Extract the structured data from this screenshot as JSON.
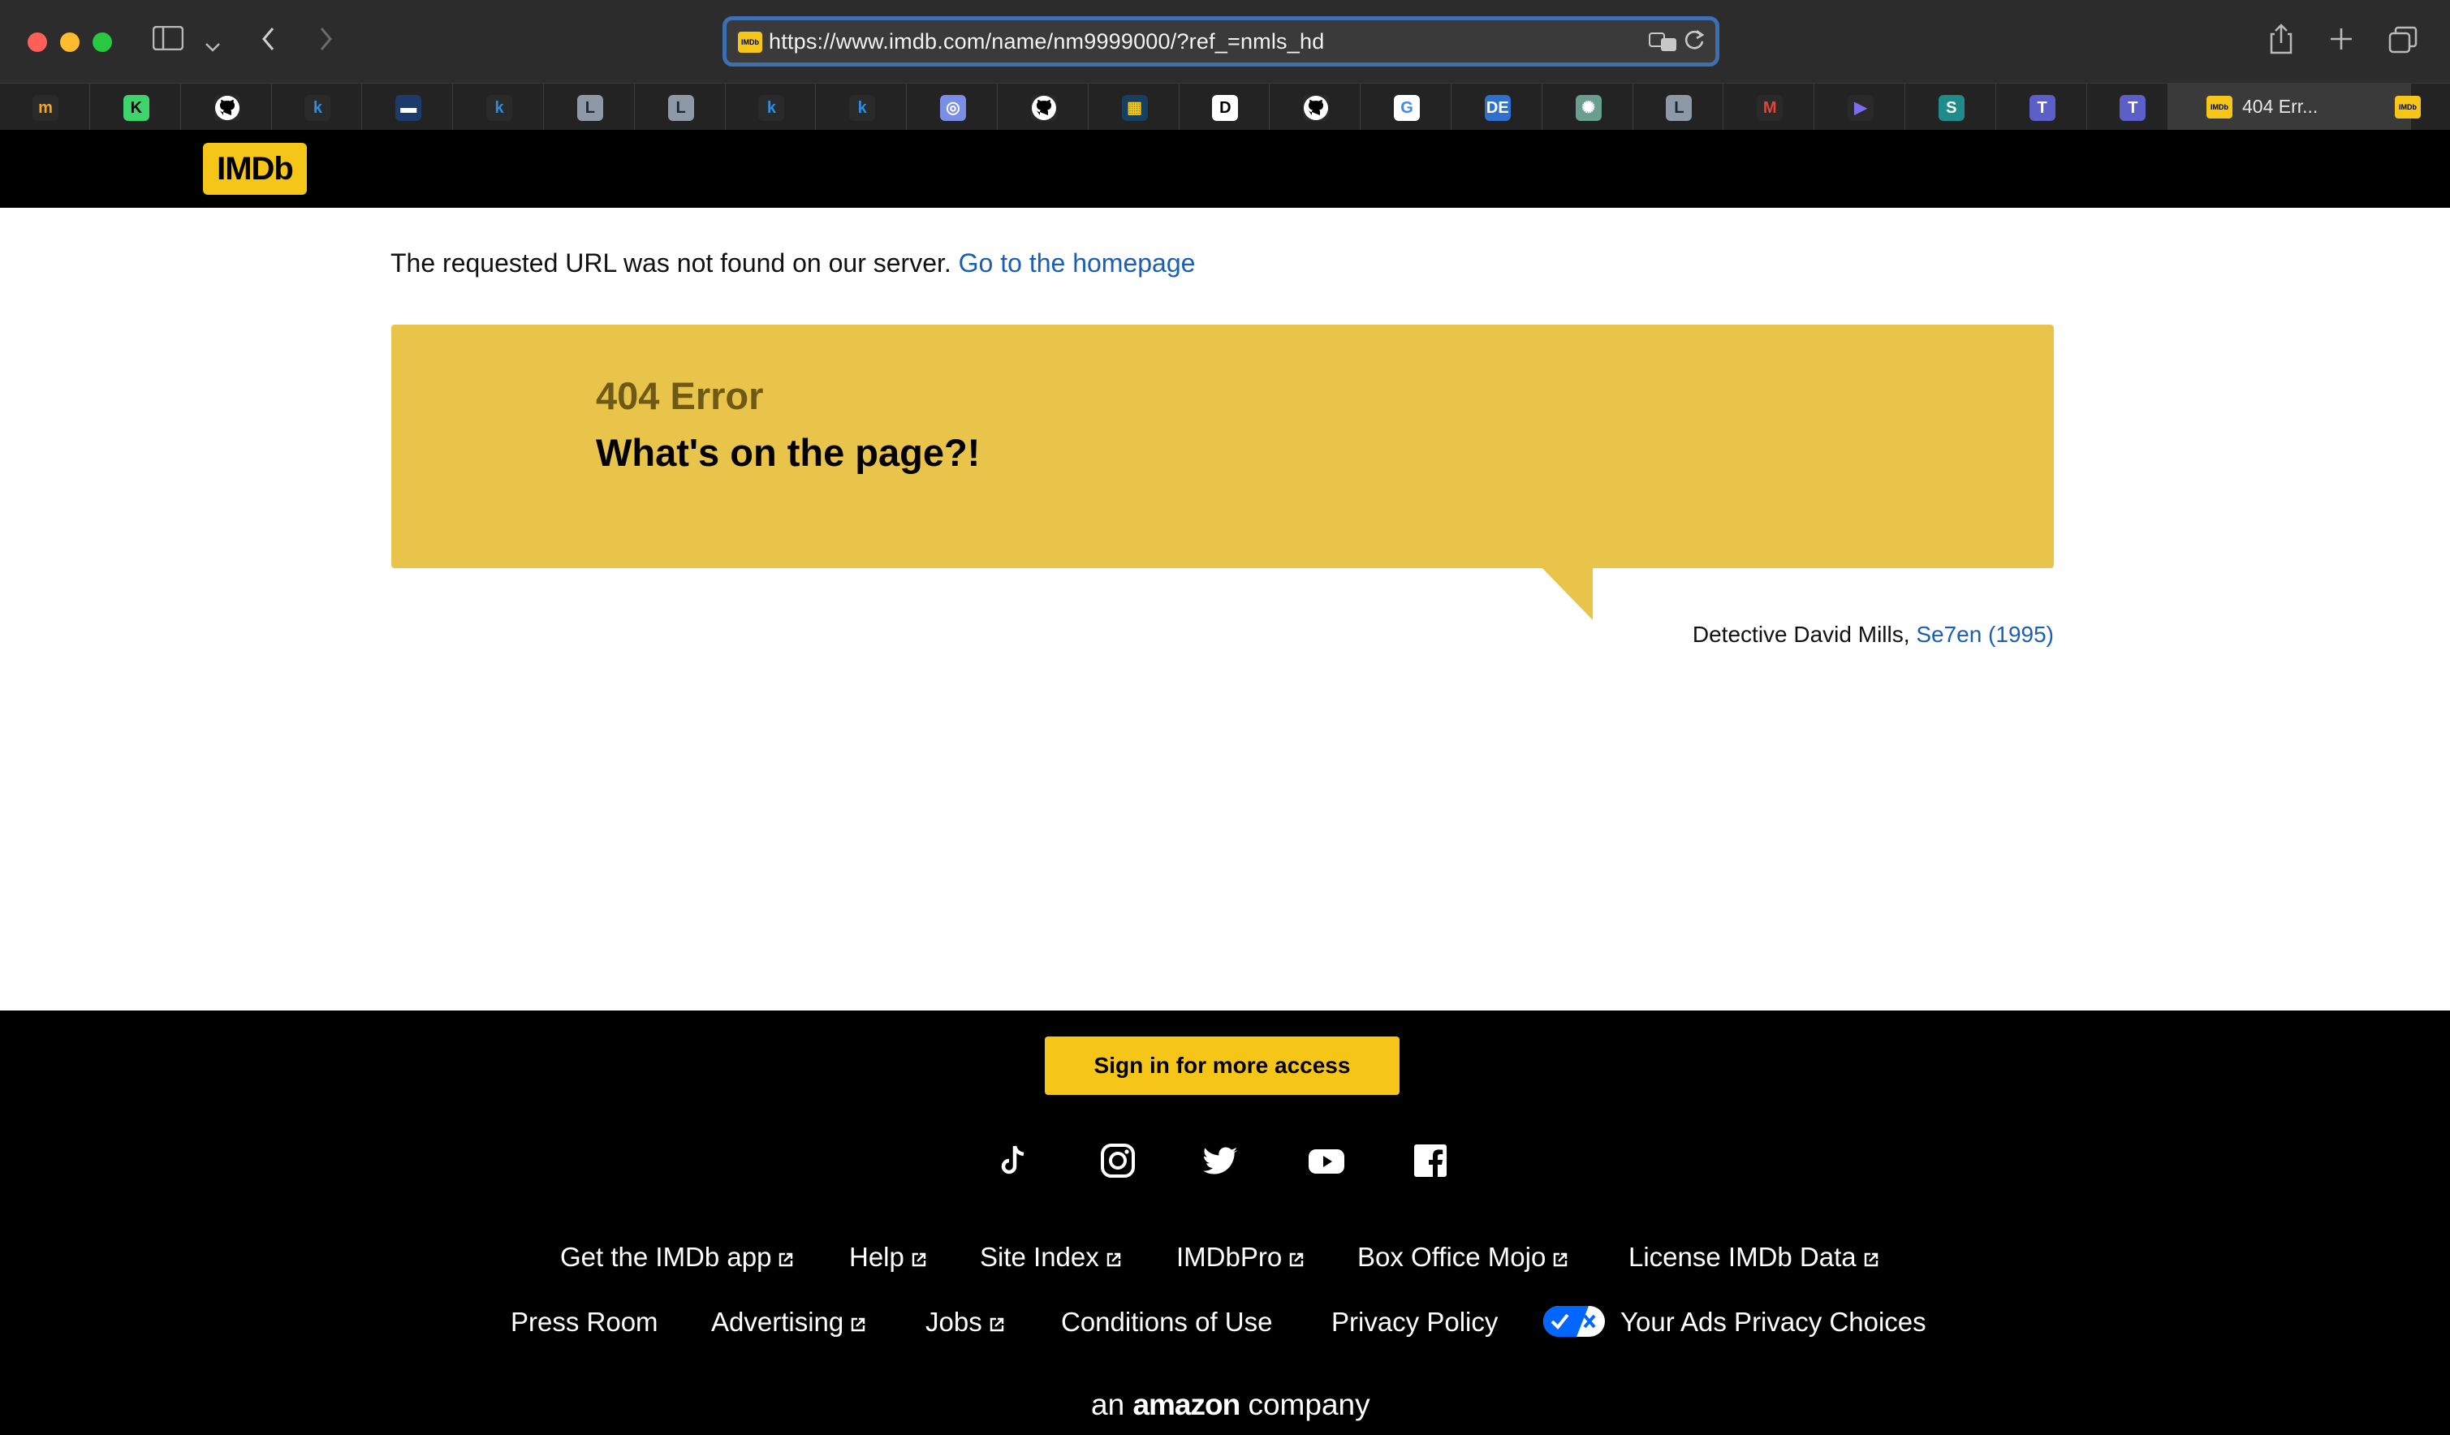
{
  "browser": {
    "url": "https://www.imdb.com/name/nm9999000/?ref_=nmls_hd",
    "active_tab_title": "404 Err...",
    "pinned_tabs": [
      {
        "icon": "imdb-pro-icon",
        "label": "m",
        "bg": "#2a2a2a",
        "fg": "#f5a623"
      },
      {
        "icon": "dk-icon",
        "label": "K",
        "bg": "#3dd46b",
        "fg": "#0b0b0b"
      },
      {
        "icon": "github-icon",
        "label": "",
        "bg": "#2a2a2a",
        "fg": "#fff"
      },
      {
        "icon": "k-icon",
        "label": "k",
        "bg": "#2a2a2a",
        "fg": "#2f8ce0"
      },
      {
        "icon": "app-blue-icon",
        "label": "▬",
        "bg": "#1c3b6b",
        "fg": "#fff"
      },
      {
        "icon": "k-icon",
        "label": "k",
        "bg": "#2a2a2a",
        "fg": "#2f8ce0"
      },
      {
        "icon": "l-icon",
        "label": "L",
        "bg": "#8e99a8",
        "fg": "#1f2733"
      },
      {
        "icon": "l-icon",
        "label": "L",
        "bg": "#8e99a8",
        "fg": "#1f2733"
      },
      {
        "icon": "k-icon",
        "label": "k",
        "bg": "#2a2a2a",
        "fg": "#2f8ce0"
      },
      {
        "icon": "k-icon",
        "label": "k",
        "bg": "#2a2a2a",
        "fg": "#2f8ce0"
      },
      {
        "icon": "ghost-icon",
        "label": "◎",
        "bg": "#7a8ee8",
        "fg": "#fff"
      },
      {
        "icon": "github-icon",
        "label": "",
        "bg": "#2a2a2a",
        "fg": "#fff"
      },
      {
        "icon": "chart-icon",
        "label": "▦",
        "bg": "#16405f",
        "fg": "#f5c518"
      },
      {
        "icon": "d-icon",
        "label": "D",
        "bg": "#fff",
        "fg": "#000"
      },
      {
        "icon": "github-icon",
        "label": "",
        "bg": "#2a2a2a",
        "fg": "#fff"
      },
      {
        "icon": "google-icon",
        "label": "G",
        "bg": "#fff",
        "fg": "#4285f4"
      },
      {
        "icon": "de-icon",
        "label": "DE",
        "bg": "#2f6fcf",
        "fg": "#fff"
      },
      {
        "icon": "chatgpt-icon",
        "label": "✺",
        "bg": "#6a9e8e",
        "fg": "#fff"
      },
      {
        "icon": "l-icon",
        "label": "L",
        "bg": "#8e99a8",
        "fg": "#1f2733"
      },
      {
        "icon": "gmail-icon",
        "label": "M",
        "bg": "#2a2a2a",
        "fg": "#e94235"
      },
      {
        "icon": "copilot-icon",
        "label": "▶",
        "bg": "#2a2a2a",
        "fg": "#7b6cf0"
      },
      {
        "icon": "sharepoint-icon",
        "label": "S",
        "bg": "#1f8b8b",
        "fg": "#fff"
      },
      {
        "icon": "teams-icon",
        "label": "T",
        "bg": "#5b5fc7",
        "fg": "#fff"
      },
      {
        "icon": "teams-icon",
        "label": "T",
        "bg": "#5b5fc7",
        "fg": "#fff"
      }
    ]
  },
  "header": {
    "logo_text": "IMDb"
  },
  "content": {
    "notfound_text": "The requested URL was not found on our server.",
    "home_link": "Go to the homepage",
    "error_code": "404 Error",
    "error_quote": "What's on the page?!",
    "quote_speaker": "Detective David Mills,",
    "quote_movie": "Se7en (1995)"
  },
  "footer": {
    "signin_label": "Sign in for more access",
    "social": [
      "tiktok-icon",
      "instagram-icon",
      "twitter-icon",
      "youtube-icon",
      "facebook-icon"
    ],
    "links_row1": [
      "Get the IMDb app",
      "Help",
      "Site Index",
      "IMDbPro",
      "Box Office Mojo",
      "License IMDb Data"
    ],
    "links_row2": [
      "Press Room",
      "Advertising",
      "Jobs",
      "Conditions of Use",
      "Privacy Policy",
      "Your Ads Privacy Choices"
    ],
    "amazon_prefix": "an",
    "amazon_brand": "amazon",
    "amazon_suffix": "company"
  },
  "colors": {
    "imdb_yellow": "#f5c518",
    "error_box": "#e9c44a",
    "link_blue": "#1a5fb4"
  }
}
